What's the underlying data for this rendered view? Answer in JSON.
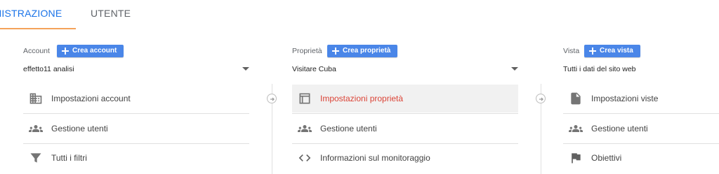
{
  "tabs": [
    {
      "label": "INISTRAZIONE",
      "active": true
    },
    {
      "label": "UTENTE",
      "active": false
    }
  ],
  "columns": {
    "account": {
      "label": "Account",
      "create_label": "Crea account",
      "selected": "effetto11 analisi",
      "items": [
        {
          "label": "Impostazioni account",
          "icon": "building-icon"
        },
        {
          "label": "Gestione utenti",
          "icon": "people-icon"
        },
        {
          "label": "Tutti i filtri",
          "icon": "filter-icon"
        }
      ]
    },
    "property": {
      "label": "Proprietà",
      "create_label": "Crea proprietà",
      "selected": "Visitare Cuba",
      "items": [
        {
          "label": "Impostazioni proprietà",
          "icon": "window-icon",
          "selected": true
        },
        {
          "label": "Gestione utenti",
          "icon": "people-icon"
        },
        {
          "label": "Informazioni sul monitoraggio",
          "icon": "code-icon"
        }
      ]
    },
    "view": {
      "label": "Vista",
      "create_label": "Crea vista",
      "selected": "Tutti i dati del sito web",
      "items": [
        {
          "label": "Impostazioni viste",
          "icon": "document-icon"
        },
        {
          "label": "Gestione utenti",
          "icon": "people-icon"
        },
        {
          "label": "Obiettivi",
          "icon": "flag-icon"
        }
      ]
    }
  },
  "colors": {
    "accent": "#1a73e8",
    "button": "#4a86e8",
    "tab_underline": "#f4a259",
    "selected_text": "#db4437"
  }
}
